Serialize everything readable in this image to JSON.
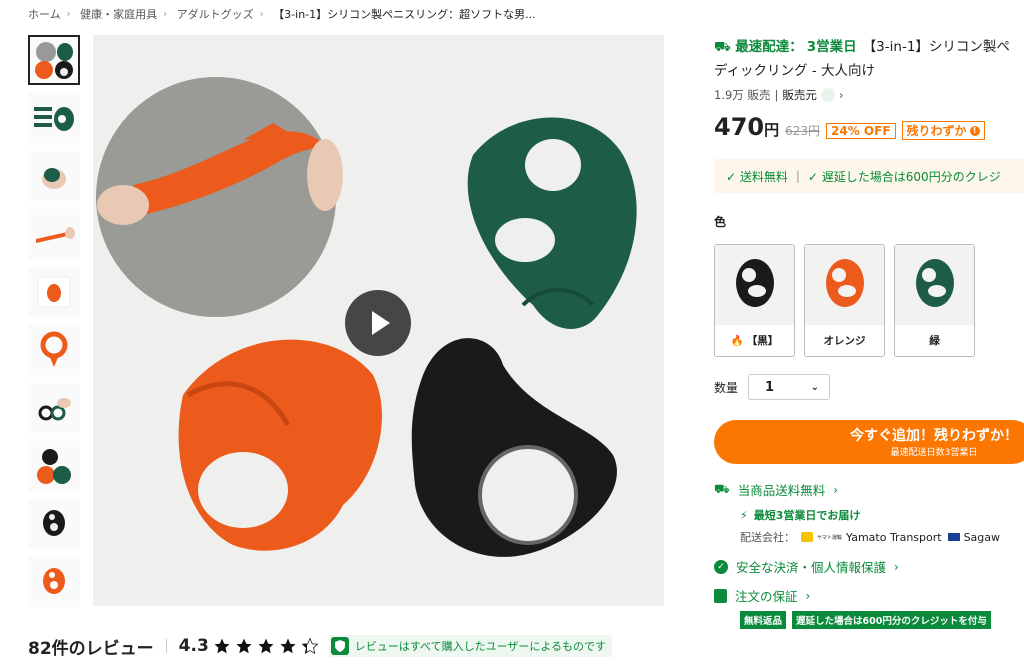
{
  "breadcrumb": [
    {
      "label": "ホーム"
    },
    {
      "label": "健康・家庭用具"
    },
    {
      "label": "アダルトグッズ"
    },
    {
      "label": "【3-in-1】シリコン製ペニスリング：超ソフトな男..."
    }
  ],
  "thumbnails": [
    "thumb-1",
    "thumb-2",
    "thumb-3",
    "thumb-4",
    "thumb-5",
    "thumb-6",
    "thumb-7",
    "thumb-8",
    "thumb-9",
    "thumb-10"
  ],
  "reviews": {
    "title": "82件のレビュー",
    "rating": "4.3",
    "stars": 4.3,
    "verified_text": "レビューはすべて購入したユーザーによるものです"
  },
  "product": {
    "fast_label": "最速配達：",
    "fast_day": "3営業日",
    "title_line1": "【3-in-1】シリコン製ペ",
    "title_line2": "ディックリング - 大人向け",
    "sold": "1.9万 販売",
    "sold_sep": "|",
    "seller_label": "販売元",
    "price": "470",
    "currency": "円",
    "old_price": "623円",
    "discount": "24% OFF",
    "low_stock": "残りわずか"
  },
  "shipping_banner": {
    "free": "✓ 送料無料",
    "sep": "|",
    "credit": "✓ 遅延した場合は600円分のクレジ"
  },
  "color": {
    "label": "色",
    "options": [
      {
        "label": "【黒】",
        "color": "#1a1a1a",
        "hot": true
      },
      {
        "label": "オレンジ",
        "color": "#ec5a1c"
      },
      {
        "label": "緑",
        "color": "#1d5c47"
      }
    ]
  },
  "quantity": {
    "label": "数量",
    "value": "1"
  },
  "add_to_cart": {
    "main": "今すぐ追加！残りわずか！",
    "sub": "最速配送日数3営業日"
  },
  "info": {
    "free_shipping": "当商品送料無料",
    "fastest": "最短3営業日でお届け",
    "carrier_label": "配送会社：",
    "carrier_brand": "ヤマト運輸",
    "carrier1": "Yamato Transport",
    "carrier2": "Sagaw",
    "secure": "安全な決済・個人情報保護",
    "guarantee": "注文の保証",
    "tag1": "無料返品",
    "tag2": "遅延した場合は600円分のクレジットを付与"
  },
  "colors": {
    "accent": "#fb7701",
    "green": "#0a8a3a"
  }
}
